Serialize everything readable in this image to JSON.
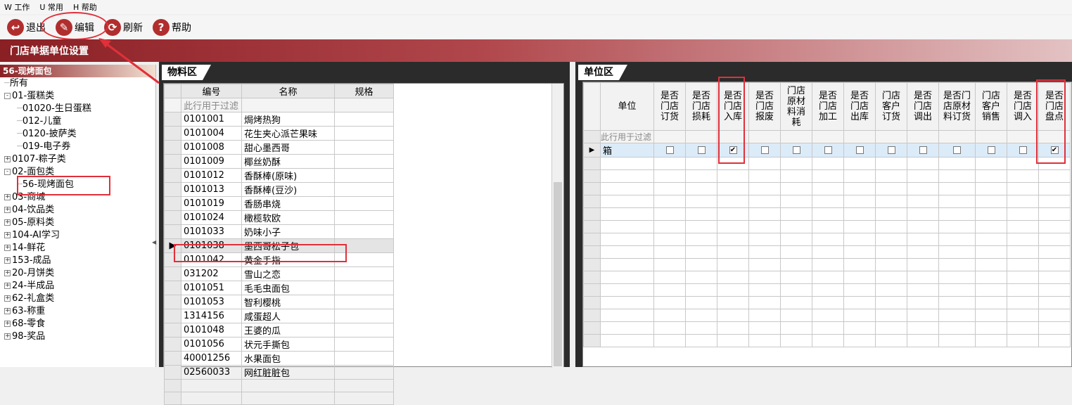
{
  "menu": [
    {
      "label": "W 工作"
    },
    {
      "label": "U 常用"
    },
    {
      "label": "H 帮助"
    }
  ],
  "toolbar": {
    "exit_label": "退出",
    "edit_label": "编辑",
    "refresh_label": "刷新",
    "help_label": "帮助"
  },
  "title": "门店单据单位设置",
  "tree": {
    "header": "56-现烤面包",
    "items": [
      {
        "label": "所有",
        "level": 0,
        "exp": ""
      },
      {
        "label": "01-蛋糕类",
        "level": 0,
        "exp": "-"
      },
      {
        "label": "01020-生日蛋糕",
        "level": 1,
        "exp": ""
      },
      {
        "label": "012-儿童",
        "level": 1,
        "exp": ""
      },
      {
        "label": "0120-披萨类",
        "level": 1,
        "exp": ""
      },
      {
        "label": "019-电子券",
        "level": 1,
        "exp": ""
      },
      {
        "label": "0107-粽子类",
        "level": 0,
        "exp": "+"
      },
      {
        "label": "02-面包类",
        "level": 0,
        "exp": "-"
      },
      {
        "label": "56-现烤面包",
        "level": 1,
        "exp": ""
      },
      {
        "label": "03-商城",
        "level": 0,
        "exp": "+"
      },
      {
        "label": "04-饮品类",
        "level": 0,
        "exp": "+"
      },
      {
        "label": "05-原料类",
        "level": 0,
        "exp": "+"
      },
      {
        "label": "104-AI学习",
        "level": 0,
        "exp": "+"
      },
      {
        "label": "14-鲜花",
        "level": 0,
        "exp": "+"
      },
      {
        "label": "153-成品",
        "level": 0,
        "exp": "+"
      },
      {
        "label": "20-月饼类",
        "level": 0,
        "exp": "+"
      },
      {
        "label": "24-半成品",
        "level": 0,
        "exp": "+"
      },
      {
        "label": "62-礼盒类",
        "level": 0,
        "exp": "+"
      },
      {
        "label": "63-称重",
        "level": 0,
        "exp": "+"
      },
      {
        "label": "68-零食",
        "level": 0,
        "exp": "+"
      },
      {
        "label": "98-奖品",
        "level": 0,
        "exp": "+"
      }
    ]
  },
  "material": {
    "tab": "物料区",
    "columns": [
      "编号",
      "名称",
      "规格"
    ],
    "filter_text": "此行用于过滤",
    "rows": [
      {
        "code": "0101001",
        "name": "焗烤热狗"
      },
      {
        "code": "0101004",
        "name": "花生夹心派芒果味"
      },
      {
        "code": "0101008",
        "name": "甜心墨西哥"
      },
      {
        "code": "0101009",
        "name": "椰丝奶酥"
      },
      {
        "code": "0101012",
        "name": "香酥棒(原味)"
      },
      {
        "code": "0101013",
        "name": "香酥棒(豆沙)"
      },
      {
        "code": "0101019",
        "name": "香肠串烧"
      },
      {
        "code": "0101024",
        "name": "橄榄软欧"
      },
      {
        "code": "0101033",
        "name": "奶味小子"
      },
      {
        "code": "0101038",
        "name": "墨西哥松子包"
      },
      {
        "code": "0101042",
        "name": "黄金手指"
      },
      {
        "code": "031202",
        "name": "雪山之恋"
      },
      {
        "code": "0101051",
        "name": "毛毛虫面包"
      },
      {
        "code": "0101053",
        "name": "智利樱桃"
      },
      {
        "code": "1314156",
        "name": "咸蛋超人"
      },
      {
        "code": "0101048",
        "name": "王婆的瓜"
      },
      {
        "code": "0101056",
        "name": "状元手撕包"
      },
      {
        "code": "40001256",
        "name": "水果面包"
      },
      {
        "code": "02560033",
        "name": "网红脏脏包"
      }
    ]
  },
  "unit": {
    "tab": "单位区",
    "unit_header": "单位",
    "filter_text": "此行用于过滤",
    "columns": [
      "是否门店订货",
      "是否门店损耗",
      "是否门店入库",
      "是否门店报废",
      "门店原材料消耗",
      "是否门店加工",
      "是否门店出库",
      "门店客户订货",
      "是否门店调出",
      "是否门店原材料订货",
      "门店客户销售",
      "是否门店调入",
      "是否门店盘点"
    ],
    "column_lines": [
      [
        "是否",
        "门店",
        "订货"
      ],
      [
        "是否",
        "门店",
        "损耗"
      ],
      [
        "是否",
        "门店",
        "入库"
      ],
      [
        "是否",
        "门店",
        "报废"
      ],
      [
        "门店",
        "原材",
        "料消",
        "耗"
      ],
      [
        "是否",
        "门店",
        "加工"
      ],
      [
        "是否",
        "门店",
        "出库"
      ],
      [
        "门店",
        "客户",
        "订货"
      ],
      [
        "是否",
        "门店",
        "调出"
      ],
      [
        "是否门",
        "店原材",
        "料订货"
      ],
      [
        "门店",
        "客户",
        "销售"
      ],
      [
        "是否",
        "门店",
        "调入"
      ],
      [
        "是否",
        "门店",
        "盘点"
      ]
    ],
    "row": {
      "unit": "箱",
      "checks": [
        false,
        false,
        true,
        false,
        false,
        false,
        false,
        false,
        false,
        false,
        false,
        false,
        true
      ]
    }
  }
}
